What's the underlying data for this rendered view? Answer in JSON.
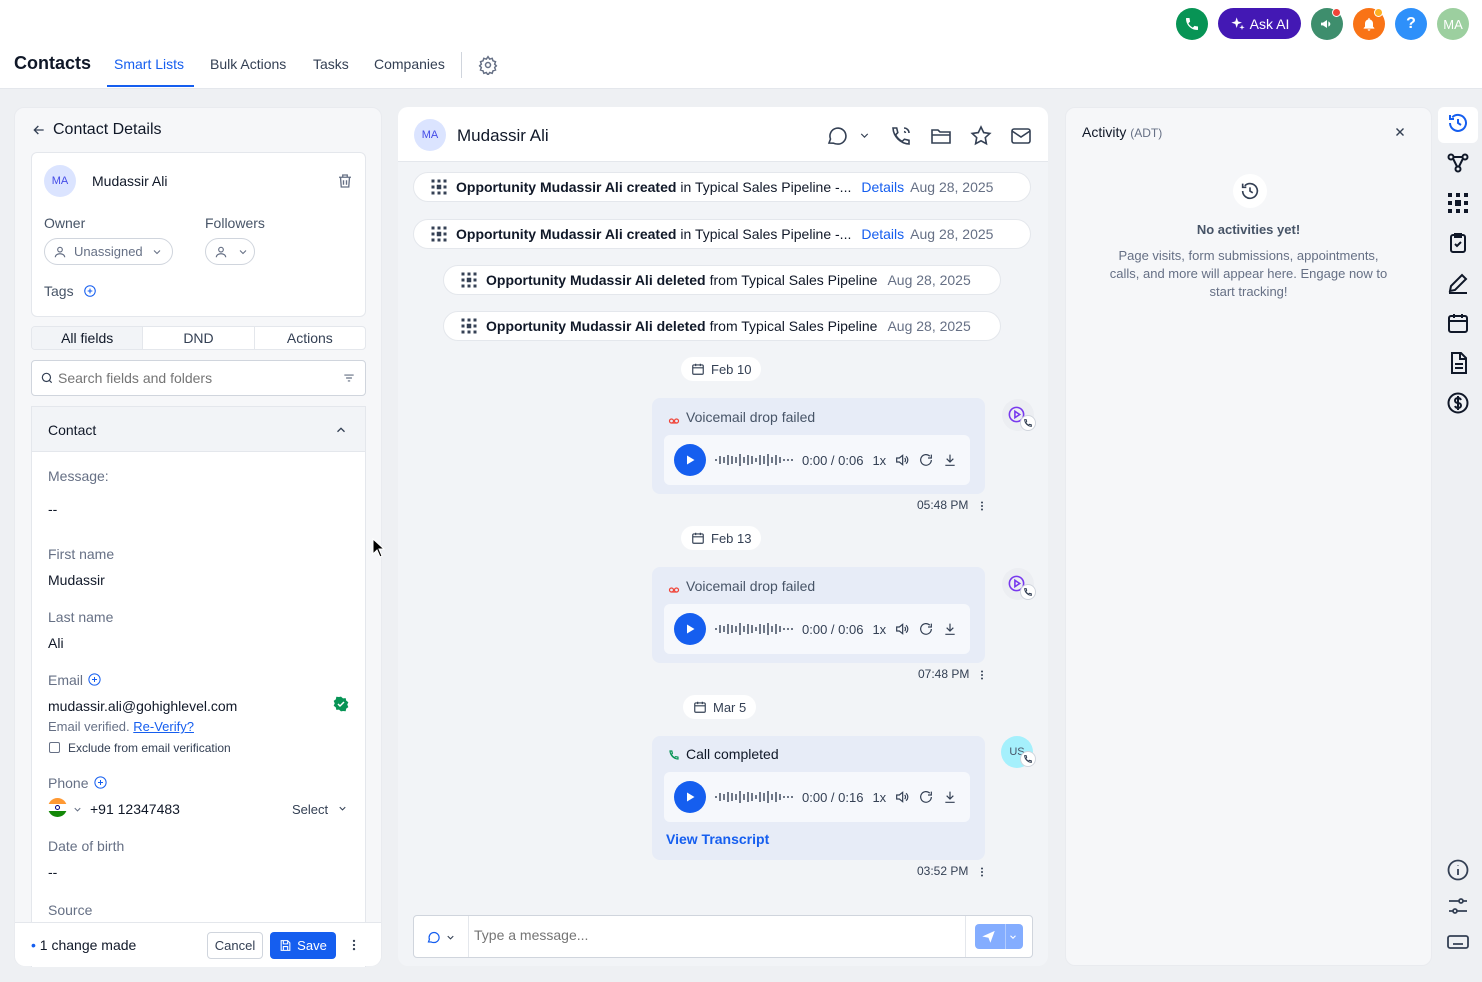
{
  "nav": {
    "title": "Contacts",
    "tabs": [
      "Smart Lists",
      "Bulk Actions",
      "Tasks",
      "Companies"
    ],
    "active_tab": "Smart Lists",
    "ask_ai": "Ask AI",
    "help": "?",
    "user_initials": "MA"
  },
  "details": {
    "header": "Contact Details",
    "contact_initials": "MA",
    "contact_name": "Mudassir Ali",
    "owner_label": "Owner",
    "owner_value": "Unassigned",
    "followers_label": "Followers",
    "tags_label": "Tags",
    "segments": [
      "All fields",
      "DND",
      "Actions"
    ],
    "search_placeholder": "Search fields and folders",
    "section_title": "Contact",
    "fields": {
      "message_label": "Message:",
      "message_value": "--",
      "first_name_label": "First name",
      "first_name_value": "Mudassir",
      "last_name_label": "Last name",
      "last_name_value": "Ali",
      "email_label": "Email",
      "email_value": "mudassir.ali@gohighlevel.com",
      "email_verified": "Email verified.",
      "reverify": "Re-Verify?",
      "exclude_label": "Exclude from email verification",
      "phone_label": "Phone",
      "phone_value": "+91 12347483",
      "phone_type": "Select",
      "dob_label": "Date of birth",
      "dob_value": "--",
      "source_label": "Source"
    },
    "footer": {
      "changes": "1 change made",
      "cancel": "Cancel",
      "save": "Save"
    }
  },
  "conversation": {
    "initials": "MA",
    "name": "Mudassir Ali",
    "events": [
      {
        "bold": "Opportunity Mudassir Ali created",
        "text": "in Typical Sales Pipeline -...",
        "link": "Details",
        "date": "Aug 28, 2025"
      },
      {
        "bold": "Opportunity Mudassir Ali created",
        "text": "in Typical Sales Pipeline -...",
        "link": "Details",
        "date": "Aug 28, 2025"
      },
      {
        "bold": "Opportunity Mudassir Ali deleted",
        "text": "from Typical Sales Pipeline",
        "link": "",
        "date": "Aug 28, 2025"
      },
      {
        "bold": "Opportunity Mudassir Ali deleted",
        "text": "from Typical Sales Pipeline",
        "link": "",
        "date": "Aug 28, 2025"
      }
    ],
    "dates": [
      "Feb 10",
      "Feb 13",
      "Mar 5"
    ],
    "calls": [
      {
        "title": "Voicemail drop failed",
        "time": "0:00 / 0:06",
        "speed": "1x",
        "stamp": "05:48 PM"
      },
      {
        "title": "Voicemail drop failed",
        "time": "0:00 / 0:06",
        "speed": "1x",
        "stamp": "07:48 PM"
      },
      {
        "title": "Call completed",
        "time": "0:00 / 0:16",
        "speed": "1x",
        "stamp": "03:52 PM",
        "link": "View Transcript",
        "avatar": "US"
      }
    ],
    "composer_placeholder": "Type a message..."
  },
  "activity": {
    "title": "Activity",
    "subtitle": "(ADT)",
    "empty_title": "No activities yet!",
    "empty_text": "Page visits, form submissions, appointments, calls, and more will appear here. Engage now to start tracking!"
  },
  "colors": {
    "primary": "#155eef",
    "phone_green": "#079455",
    "ask_ai": "#4318b4",
    "announce": "#3e8e6d",
    "bell": "#f97316",
    "help": "#2e90fa",
    "avatar": "#9ccf9f"
  }
}
